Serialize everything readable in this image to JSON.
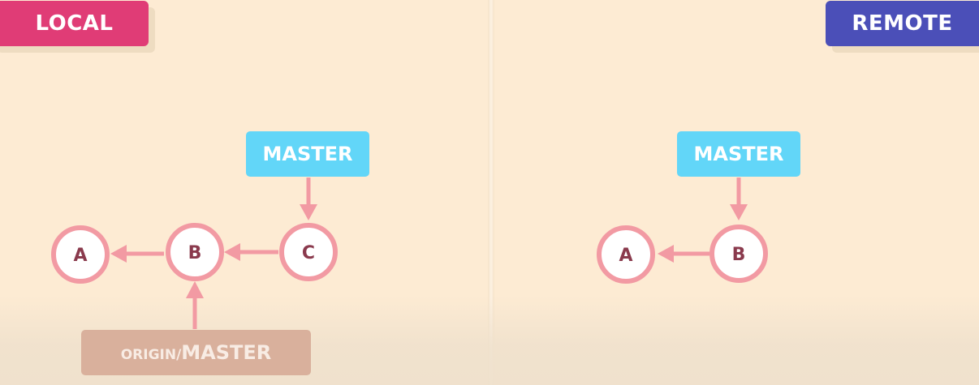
{
  "local": {
    "label": "LOCAL",
    "commits": [
      "A",
      "B",
      "C"
    ],
    "master_ref": "MASTER",
    "origin_ref_prefix": "ORIGIN/",
    "origin_ref_name": "MASTER"
  },
  "remote": {
    "label": "REMOTE",
    "commits": [
      "A",
      "B"
    ],
    "master_ref": "MASTER"
  },
  "colors": {
    "local_badge": "#e03c76",
    "remote_badge": "#4b4fb8",
    "master_ref": "#62d6f8",
    "origin_ref": "#d9b09c",
    "commit_stroke": "#f29aa3",
    "arrow": "#f29aa3",
    "commit_text": "#8a3a4d",
    "background": "#fdebd3"
  }
}
